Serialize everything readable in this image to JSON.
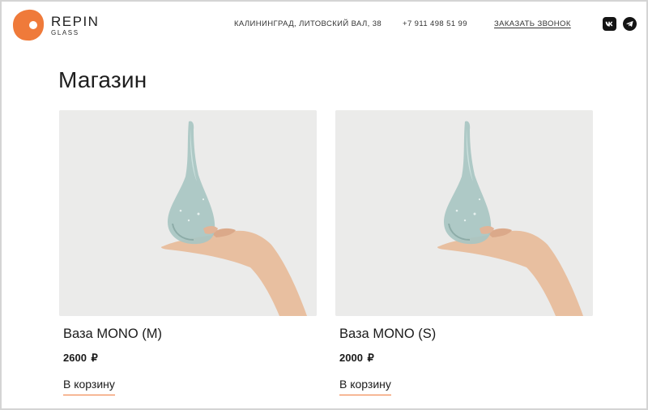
{
  "brand": {
    "name": "REPIN",
    "sub": "GLASS",
    "accent_color": "#ef7a3a"
  },
  "header": {
    "address": "КАЛИНИНГРАД, ЛИТОВСКИЙ ВАЛ, 38",
    "phone": "+7 911 498 51 99",
    "callback_label": "ЗАКАЗАТЬ ЗВОНОК",
    "social": [
      "vk-icon",
      "telegram-icon"
    ]
  },
  "page": {
    "title": "Магазин"
  },
  "products": [
    {
      "name": "Ваза MONO (M)",
      "price": "2600",
      "currency": "₽",
      "cart_label": "В корзину"
    },
    {
      "name": "Ваза MONO (S)",
      "price": "2000",
      "currency": "₽",
      "cart_label": "В корзину"
    }
  ]
}
